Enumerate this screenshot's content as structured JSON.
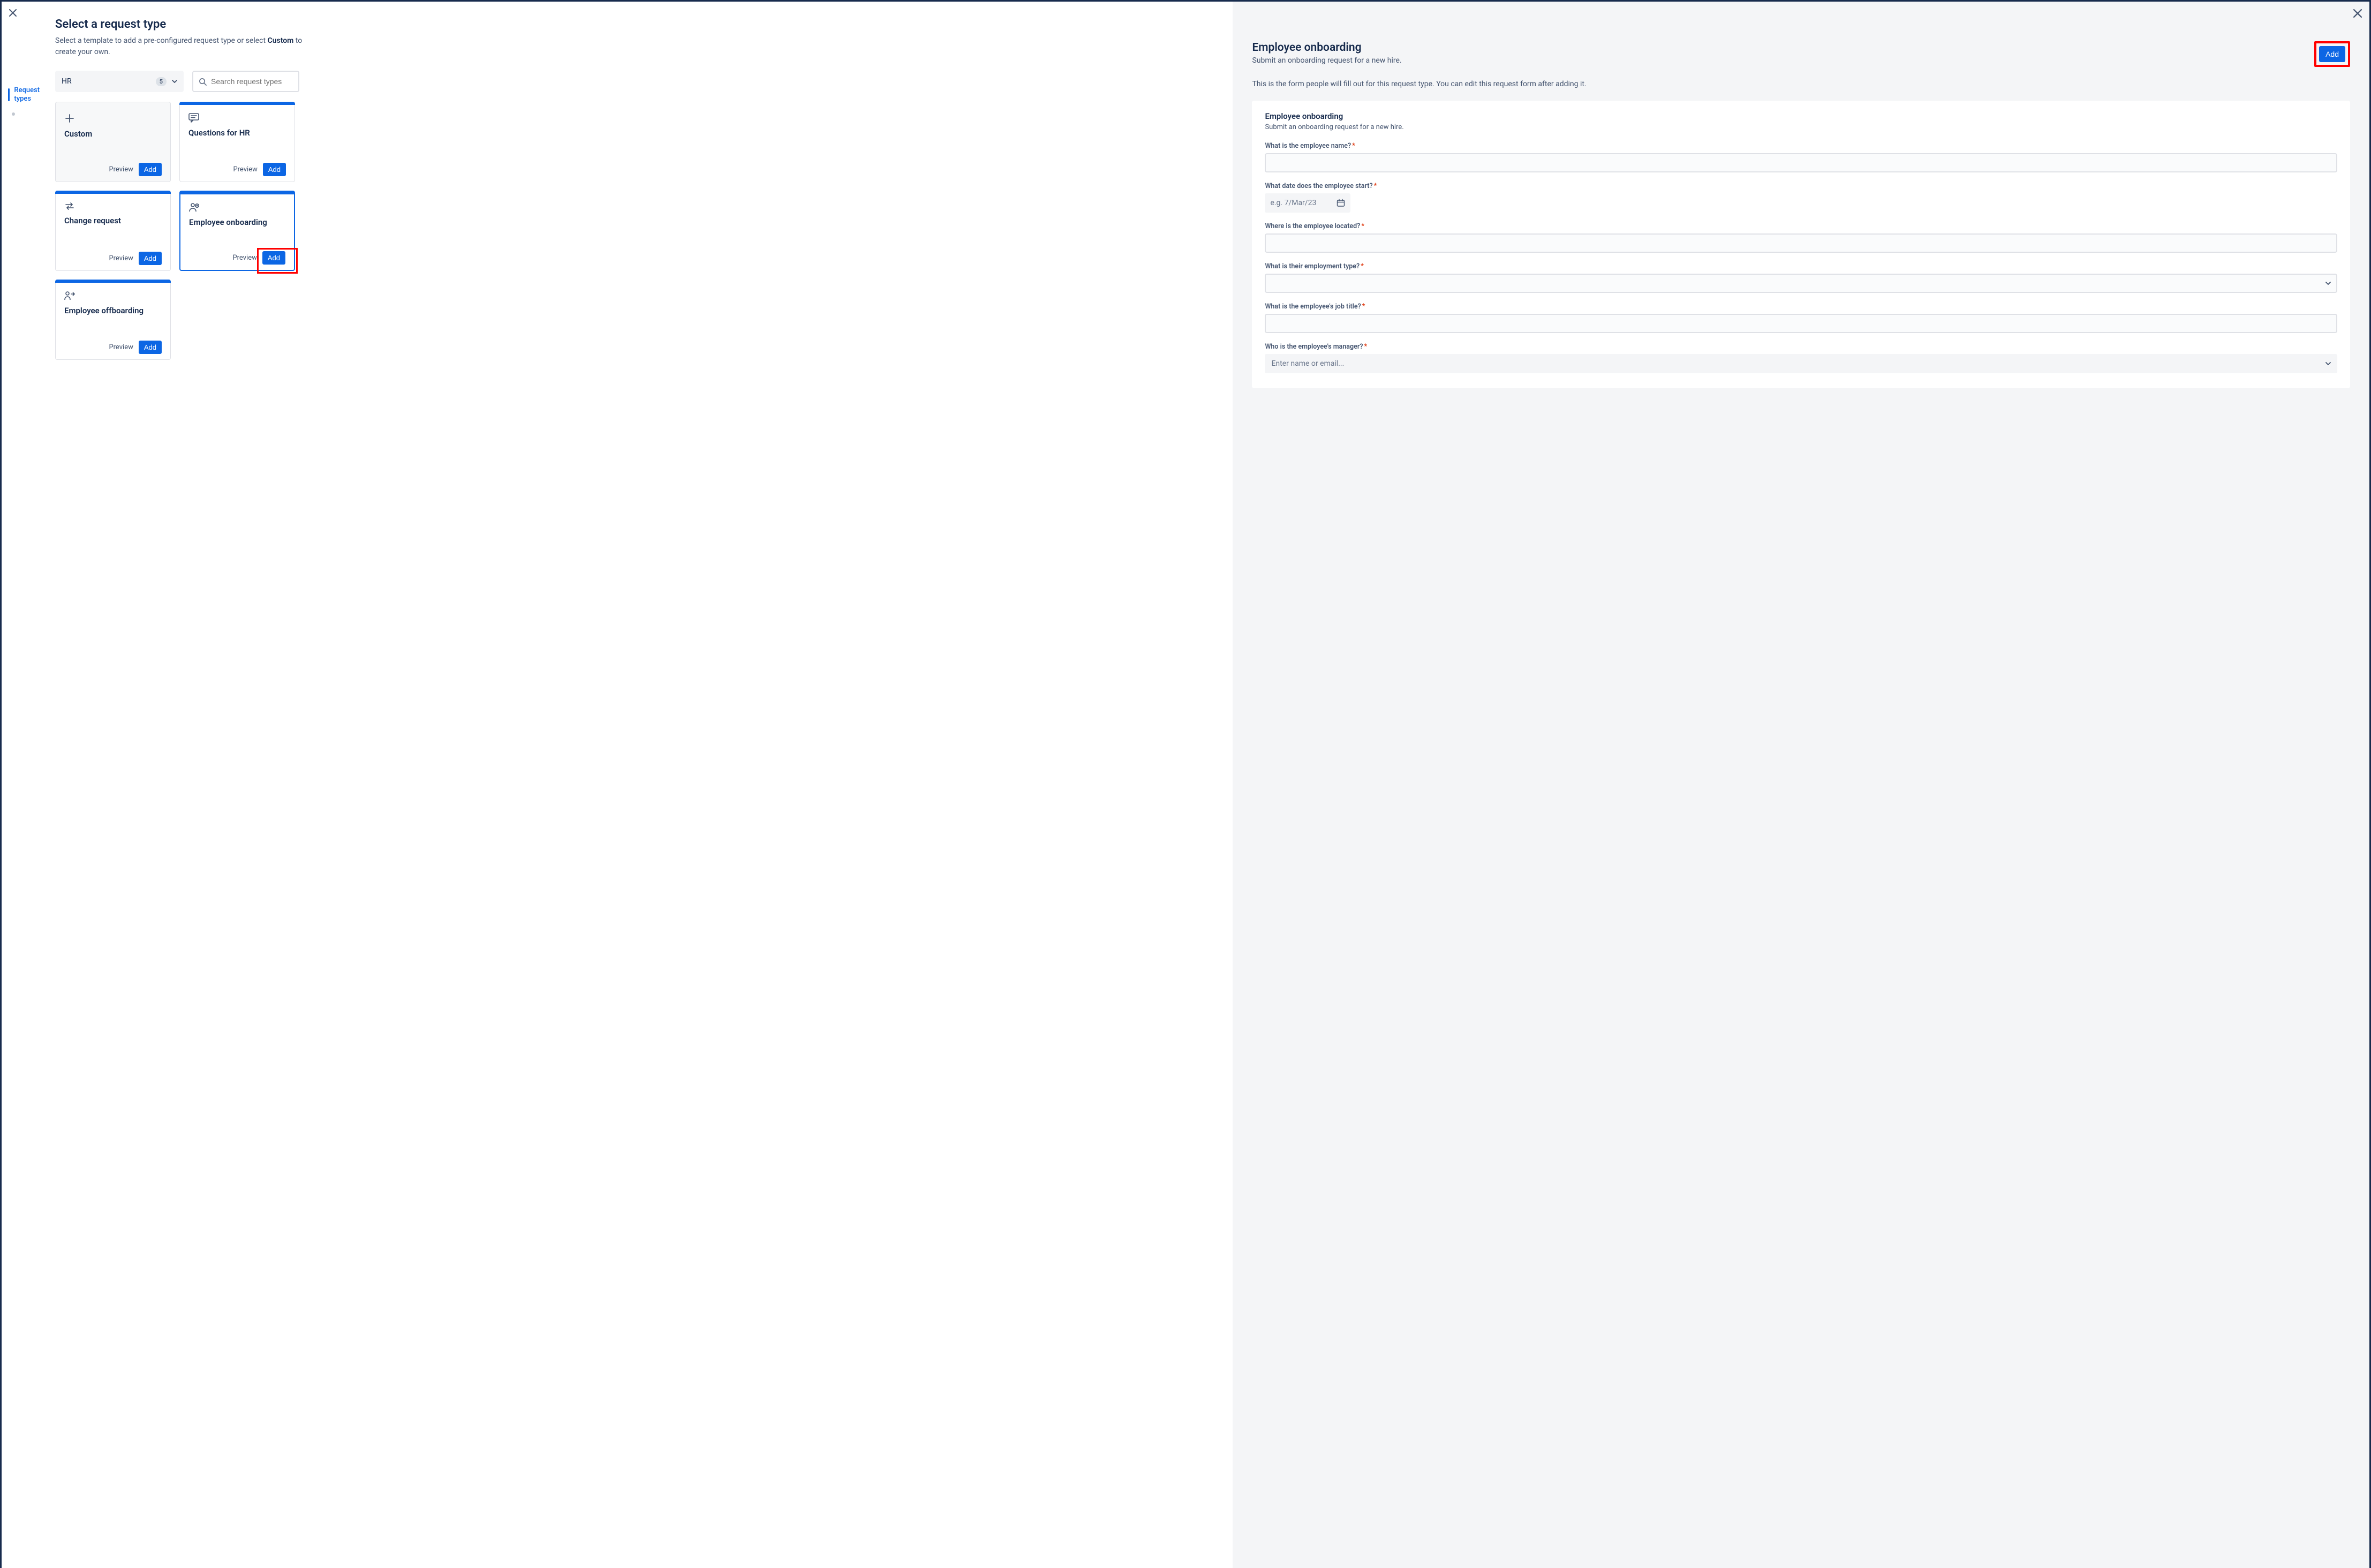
{
  "left": {
    "title": "Select a request type",
    "subtitle_pre": "Select a template to add a pre-configured request type or select ",
    "subtitle_bold": "Custom",
    "subtitle_post": " to create your own.",
    "tab_label": "Request types"
  },
  "filter": {
    "category": "HR",
    "count": "5",
    "search_placeholder": "Search request types"
  },
  "cards": {
    "custom": {
      "title": "Custom"
    },
    "questions": {
      "title": "Questions for HR"
    },
    "change": {
      "title": "Change request"
    },
    "onboarding": {
      "title": "Employee onboarding"
    },
    "offboarding": {
      "title": "Employee offboarding"
    },
    "preview_label": "Preview",
    "add_label": "Add"
  },
  "preview": {
    "title": "Employee onboarding",
    "subtitle": "Submit an onboarding request for a new hire.",
    "description": "This is the form people will fill out for this request type. You can edit this request form after adding it.",
    "add_label": "Add"
  },
  "form": {
    "title": "Employee onboarding",
    "subtitle": "Submit an onboarding request for a new hire.",
    "fields": {
      "name": {
        "label": "What is the employee name?"
      },
      "start": {
        "label": "What date does the employee start?",
        "placeholder": "e.g. 7/Mar/23"
      },
      "location": {
        "label": "Where is the employee located?"
      },
      "type": {
        "label": "What is their employment type?"
      },
      "title": {
        "label": "What is the employee's job title?"
      },
      "manager": {
        "label": "Who is the employee's manager?",
        "placeholder": "Enter name or email..."
      }
    }
  }
}
